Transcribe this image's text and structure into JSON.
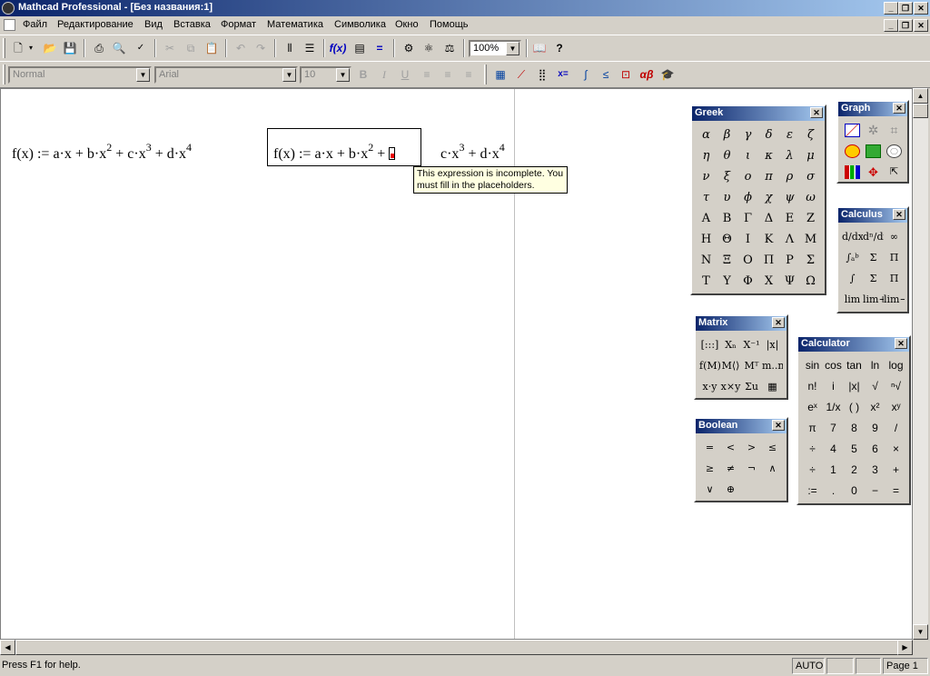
{
  "window": {
    "title": "Mathcad Professional - [Без названия:1]",
    "buttons": [
      "_",
      "❐",
      "✕"
    ]
  },
  "menu": [
    "Файл",
    "Редактирование",
    "Вид",
    "Вставка",
    "Формат",
    "Математика",
    "Символика",
    "Окно",
    "Помощь"
  ],
  "toolbar1": {
    "zoom": "100%",
    "icons": [
      "new-icon",
      "open-icon",
      "save-icon",
      "print-icon",
      "print-preview-icon",
      "spellcheck-icon",
      "cut-icon",
      "copy-icon",
      "paste-icon",
      "undo-icon",
      "redo-icon",
      "align-across-icon",
      "align-down-icon",
      "insert-function-icon",
      "insert-unit-icon",
      "calculate-icon",
      "component-icon",
      "resource-icon",
      "component-wizard-icon",
      "resource-center-icon",
      "help-icon"
    ]
  },
  "toolbar2": {
    "style": "Normal",
    "font": "Arial",
    "size": "10",
    "bold": "B",
    "italic": "I",
    "underline": "U"
  },
  "worksheet": {
    "expr1": {
      "lhs": "f(x)",
      "assign": ":=",
      "t1": "a·x + b·x",
      "p1": "2",
      "t2": "+ c·x",
      "p2": "3",
      "t3": "+ d·x",
      "p3": "4"
    },
    "expr2": {
      "lhs": "f(x)",
      "assign": ":=",
      "t1": "a·x + b·x",
      "p1": "2",
      "t2": "+",
      "t3": "c·x",
      "p3": "3",
      "t4": "+ d·x",
      "p4": "4"
    },
    "tooltip": "This expression is incomplete. You must fill in the placeholders."
  },
  "statusbar": {
    "help": "Press F1 for help.",
    "mode": "AUTO",
    "page": "Page 1"
  },
  "palettes": {
    "greek": {
      "title": "Greek",
      "symbols": [
        "α",
        "β",
        "γ",
        "δ",
        "ε",
        "ζ",
        "η",
        "θ",
        "ι",
        "κ",
        "λ",
        "μ",
        "ν",
        "ξ",
        "ο",
        "π",
        "ρ",
        "σ",
        "τ",
        "υ",
        "ϕ",
        "χ",
        "ψ",
        "ω",
        "Α",
        "Β",
        "Γ",
        "Δ",
        "Ε",
        "Ζ",
        "Η",
        "Θ",
        "Ι",
        "Κ",
        "Λ",
        "Μ",
        "Ν",
        "Ξ",
        "Ο",
        "Π",
        "Ρ",
        "Σ",
        "Τ",
        "Υ",
        "Φ",
        "Χ",
        "Ψ",
        "Ω"
      ]
    },
    "graph": {
      "title": "Graph"
    },
    "calculus": {
      "title": "Calculus",
      "symbols": [
        "d/dx",
        "dⁿ/dxⁿ",
        "∞",
        "∫ₐᵇ",
        "Σ",
        "Π",
        "∫",
        "Σ",
        "Π",
        "lim",
        "lim+",
        "lim−"
      ]
    },
    "matrix": {
      "title": "Matrix",
      "symbols": [
        "[:::]",
        "Xₙ",
        "X⁻¹",
        "|x|",
        "f(M)",
        "M⟨⟩",
        "Mᵀ",
        "m..n",
        "x·y",
        "x×y",
        "Σu",
        "▦"
      ]
    },
    "boolean": {
      "title": "Boolean",
      "symbols": [
        "=",
        "<",
        ">",
        "≤",
        "≥",
        "≠",
        "¬",
        "∧",
        "∨",
        "⊕"
      ]
    },
    "calculator": {
      "title": "Calculator",
      "symbols": [
        "sin",
        "cos",
        "tan",
        "ln",
        "log",
        "n!",
        "i",
        "|x|",
        "√",
        "ⁿ√",
        "eˣ",
        "1/x",
        "( )",
        "x²",
        "xʸ",
        "π",
        "7",
        "8",
        "9",
        "/",
        "÷",
        "4",
        "5",
        "6",
        "×",
        "÷",
        "1",
        "2",
        "3",
        "+",
        ":=",
        ".",
        "0",
        "−",
        "="
      ]
    }
  }
}
